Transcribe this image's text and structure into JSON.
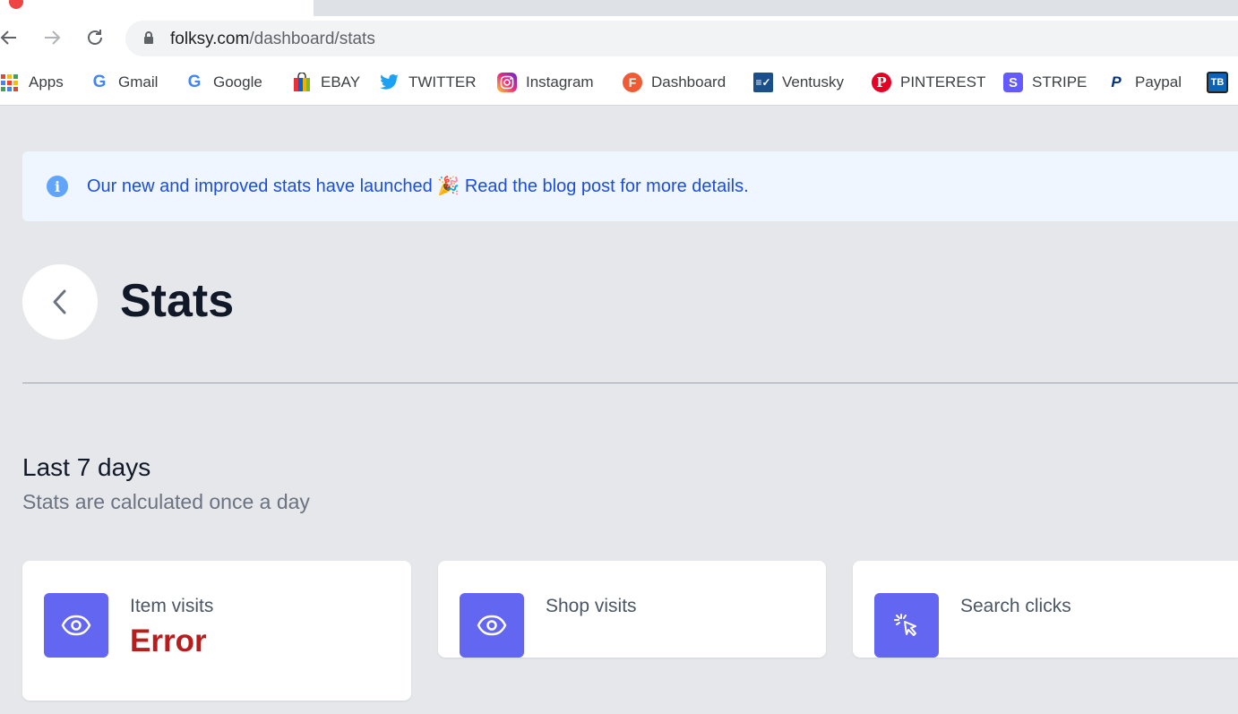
{
  "browser": {
    "url_domain": "folksy.com",
    "url_path": "/dashboard/stats"
  },
  "bookmarks": [
    {
      "label": "Apps",
      "icon": "apps-grid-icon"
    },
    {
      "label": "Gmail",
      "icon": "google-g-icon"
    },
    {
      "label": "Google",
      "icon": "google-g-icon"
    },
    {
      "label": "EBAY",
      "icon": "shopping-bag-icon"
    },
    {
      "label": "TWITTER",
      "icon": "twitter-bird-icon"
    },
    {
      "label": "Instagram",
      "icon": "instagram-icon"
    },
    {
      "label": "Dashboard",
      "icon": "folksy-f-icon"
    },
    {
      "label": "Ventusky",
      "icon": "ventusky-icon"
    },
    {
      "label": "PINTEREST",
      "icon": "pinterest-icon"
    },
    {
      "label": "STRIPE",
      "icon": "stripe-s-icon"
    },
    {
      "label": "Paypal",
      "icon": "paypal-icon"
    },
    {
      "label": "",
      "icon": "tb-icon"
    }
  ],
  "banner": {
    "text_before": "Our new and improved stats have launched",
    "emoji": "🎉",
    "link_text": "Read the blog post for more details."
  },
  "header": {
    "title": "Stats"
  },
  "section": {
    "title": "Last 7 days",
    "subtitle": "Stats are calculated once a day"
  },
  "cards": [
    {
      "label": "Item visits",
      "value": "Error",
      "icon": "eye-icon"
    },
    {
      "label": "Shop visits",
      "value": "",
      "icon": "eye-icon"
    },
    {
      "label": "Search clicks",
      "value": "",
      "icon": "cursor-click-icon"
    }
  ],
  "colors": {
    "accent": "#6366f1",
    "error": "#b91c1c",
    "banner_bg": "#eff6ff",
    "banner_text": "#1d4ed8",
    "page_bg": "#e5e7eb"
  }
}
